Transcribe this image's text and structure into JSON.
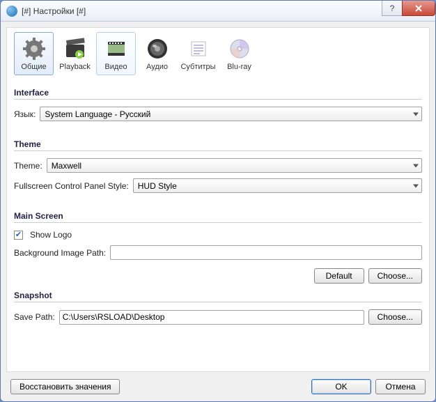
{
  "window": {
    "title": "[#] Настройки [#]"
  },
  "toolbar": {
    "tabs": [
      {
        "label": "Общие"
      },
      {
        "label": "Playback"
      },
      {
        "label": "Видео"
      },
      {
        "label": "Аудио"
      },
      {
        "label": "Субтитры"
      },
      {
        "label": "Blu-ray"
      }
    ]
  },
  "sections": {
    "interface": {
      "title": "Interface",
      "language_label": "Язык:",
      "language_value": "System Language - Русский"
    },
    "theme": {
      "title": "Theme",
      "theme_label": "Theme:",
      "theme_value": "Maxwell",
      "fcps_label": "Fullscreen Control Panel Style:",
      "fcps_value": "HUD Style"
    },
    "main_screen": {
      "title": "Main Screen",
      "show_logo_label": "Show Logo",
      "show_logo_checked": true,
      "bg_path_label": "Background Image Path:",
      "bg_path_value": "",
      "default_btn": "Default",
      "choose_btn": "Choose..."
    },
    "snapshot": {
      "title": "Snapshot",
      "save_path_label": "Save Path:",
      "save_path_value": "C:\\Users\\RSLOAD\\Desktop",
      "choose_btn": "Choose..."
    }
  },
  "footer": {
    "restore": "Восстановить значения",
    "ok": "OK",
    "cancel": "Отмена"
  }
}
